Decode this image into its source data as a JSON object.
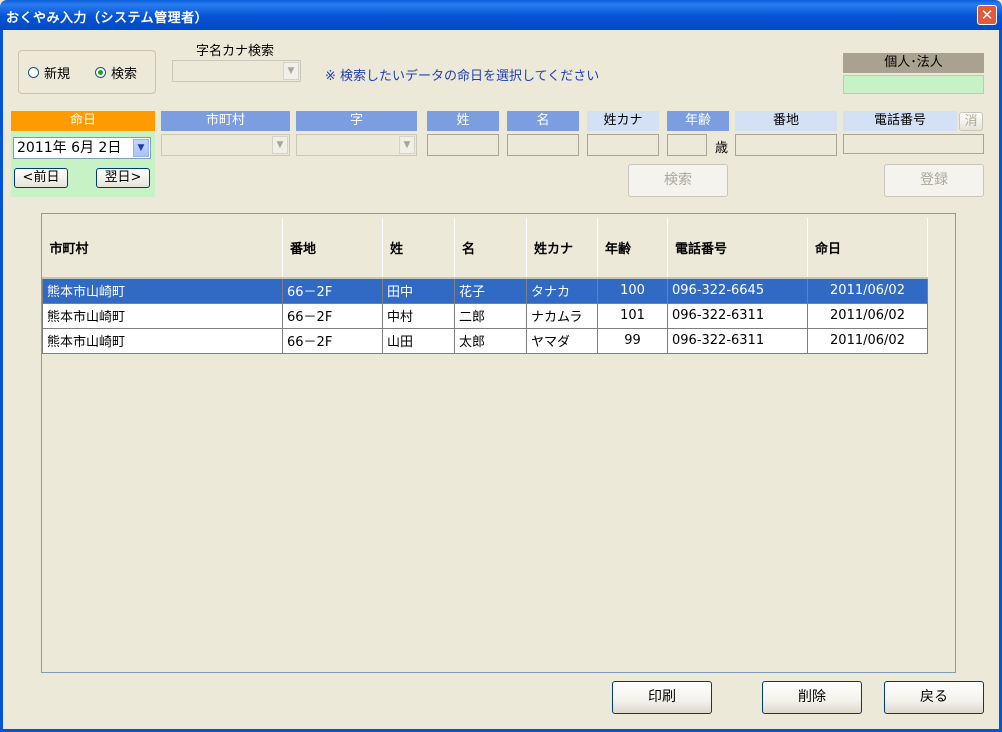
{
  "window": {
    "title": "おくやみ入力（システム管理者）",
    "close_label": "✕"
  },
  "mode": {
    "new_label": "新規",
    "search_label": "検索",
    "selected": "search"
  },
  "kana_search": {
    "label": "字名カナ検索",
    "value": ""
  },
  "note": "※ 検索したいデータの命日を選択してください",
  "person_type": {
    "label": "個人･法人",
    "value": ""
  },
  "headers": {
    "meinichi": "命日",
    "shichoson": "市町村",
    "aza": "字",
    "sei": "姓",
    "mei": "名",
    "sei_kana": "姓カナ",
    "nenrei": "年齢",
    "banchi": "番地",
    "denwa": "電話番号",
    "clear": "消"
  },
  "age_unit": "歳",
  "date": {
    "value": "2011年 6月 2日",
    "prev_label": "<前日",
    "next_label": "翌日>"
  },
  "buttons": {
    "search": "検索",
    "register": "登録",
    "print": "印刷",
    "delete": "削除",
    "back": "戻る"
  },
  "table": {
    "columns": [
      "市町村",
      "番地",
      "姓",
      "名",
      "姓カナ",
      "年齢",
      "電話番号",
      "命日"
    ],
    "rows": [
      [
        "熊本市山崎町",
        "66－2F",
        "田中",
        "花子",
        "タナカ",
        "100",
        "096-322-6645",
        "2011/06/02"
      ],
      [
        "熊本市山崎町",
        "66－2F",
        "中村",
        "二郎",
        "ナカムラ",
        "101",
        "096-322-6311",
        "2011/06/02"
      ],
      [
        "熊本市山崎町",
        "66－2F",
        "山田",
        "太郎",
        "ヤマダ",
        "99",
        "096-322-6311",
        "2011/06/02"
      ]
    ],
    "selected_row": 0
  },
  "colors": {
    "titlebar": "#0454d4",
    "header_blue": "#7c9ee0",
    "header_orange": "#ff9b00",
    "date_panel": "#c6f2c6",
    "selection": "#316ac5"
  }
}
